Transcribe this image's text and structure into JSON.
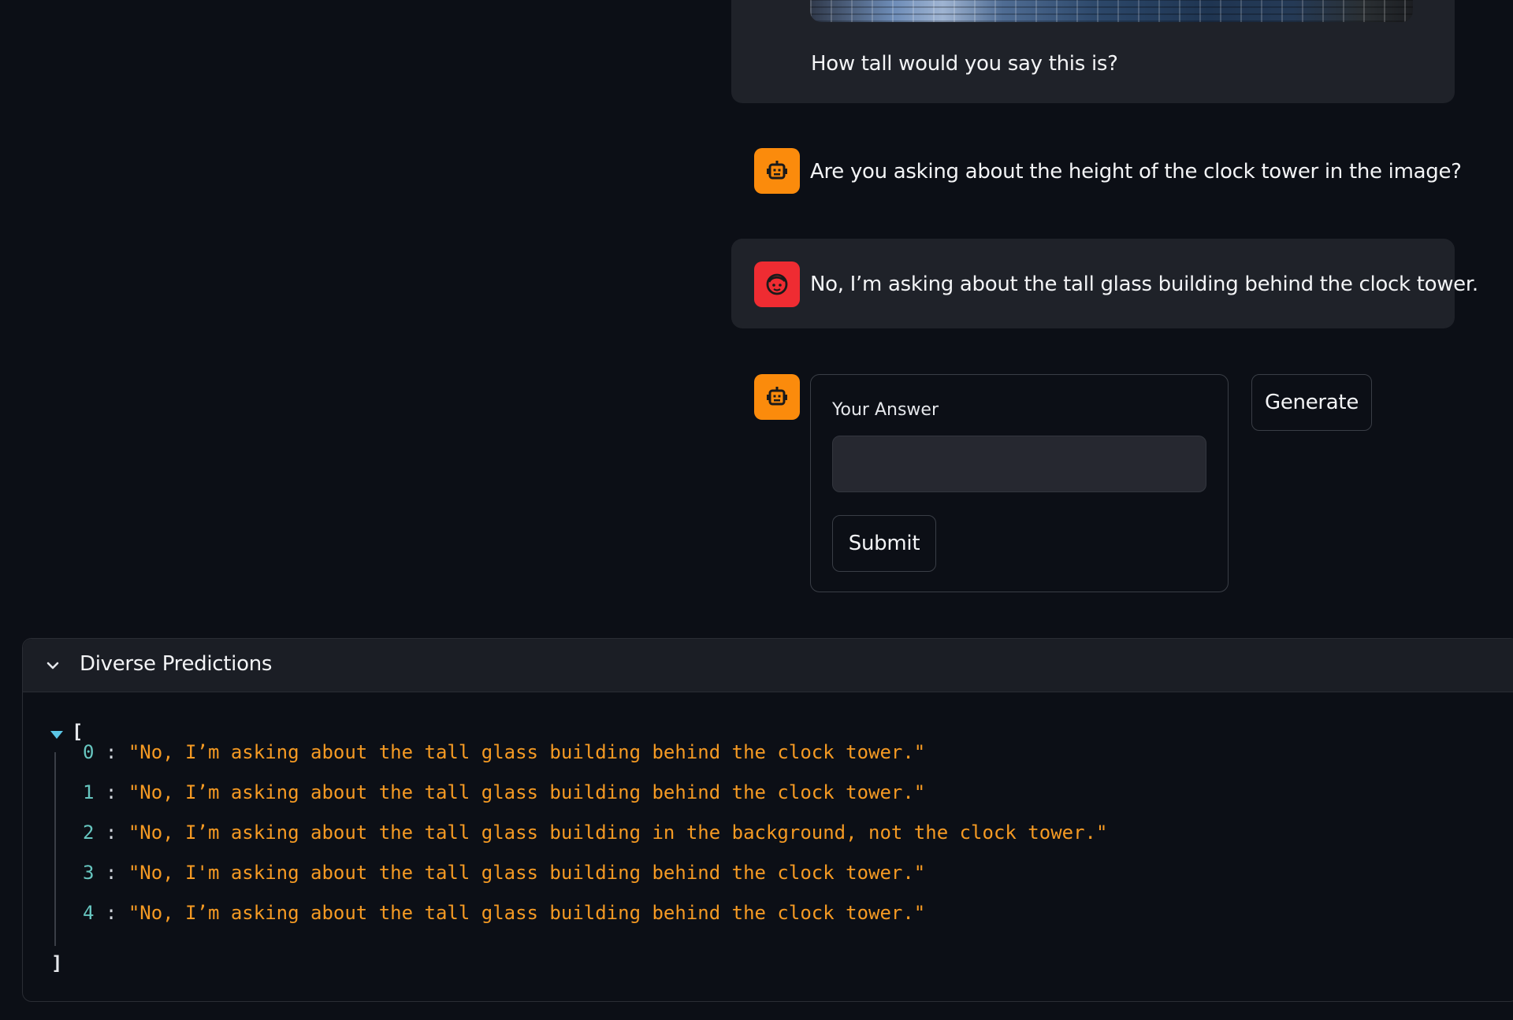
{
  "chat": {
    "messages": [
      {
        "role": "user",
        "text": "How tall would you say this is?"
      },
      {
        "role": "bot",
        "text": "Are you asking about the height of the clock tower in the image?"
      },
      {
        "role": "user",
        "text": "No, I’m asking about the tall glass building behind the clock tower."
      }
    ],
    "avatars": {
      "bot_icon": "robot-icon",
      "bot_color": "#fb8b0c",
      "user_icon": "face-icon",
      "user_color": "#ef2c32"
    }
  },
  "answer_form": {
    "label": "Your Answer",
    "value": "",
    "placeholder": "",
    "submit_label": "Submit"
  },
  "generate_label": "Generate",
  "predictions": {
    "title": "Diverse Predictions",
    "expanded": true,
    "open_bracket": "[",
    "close_bracket": "]",
    "items": [
      {
        "index": "0",
        "value": "\"No, I’m asking about the tall glass building behind the clock tower.\""
      },
      {
        "index": "1",
        "value": "\"No, I’m asking about the tall glass building behind the clock tower.\""
      },
      {
        "index": "2",
        "value": "\"No, I’m asking about the tall glass building in the background, not the clock tower.\""
      },
      {
        "index": "3",
        "value": "\"No, I'm asking about the tall glass building behind the clock tower.\""
      },
      {
        "index": "4",
        "value": "\"No, I’m asking about the tall glass building behind the clock tower.\""
      }
    ]
  },
  "colors": {
    "background": "#0c0f16",
    "bubble": "#1f2229",
    "json_index": "#67c6c0",
    "json_string": "#f59a23"
  }
}
